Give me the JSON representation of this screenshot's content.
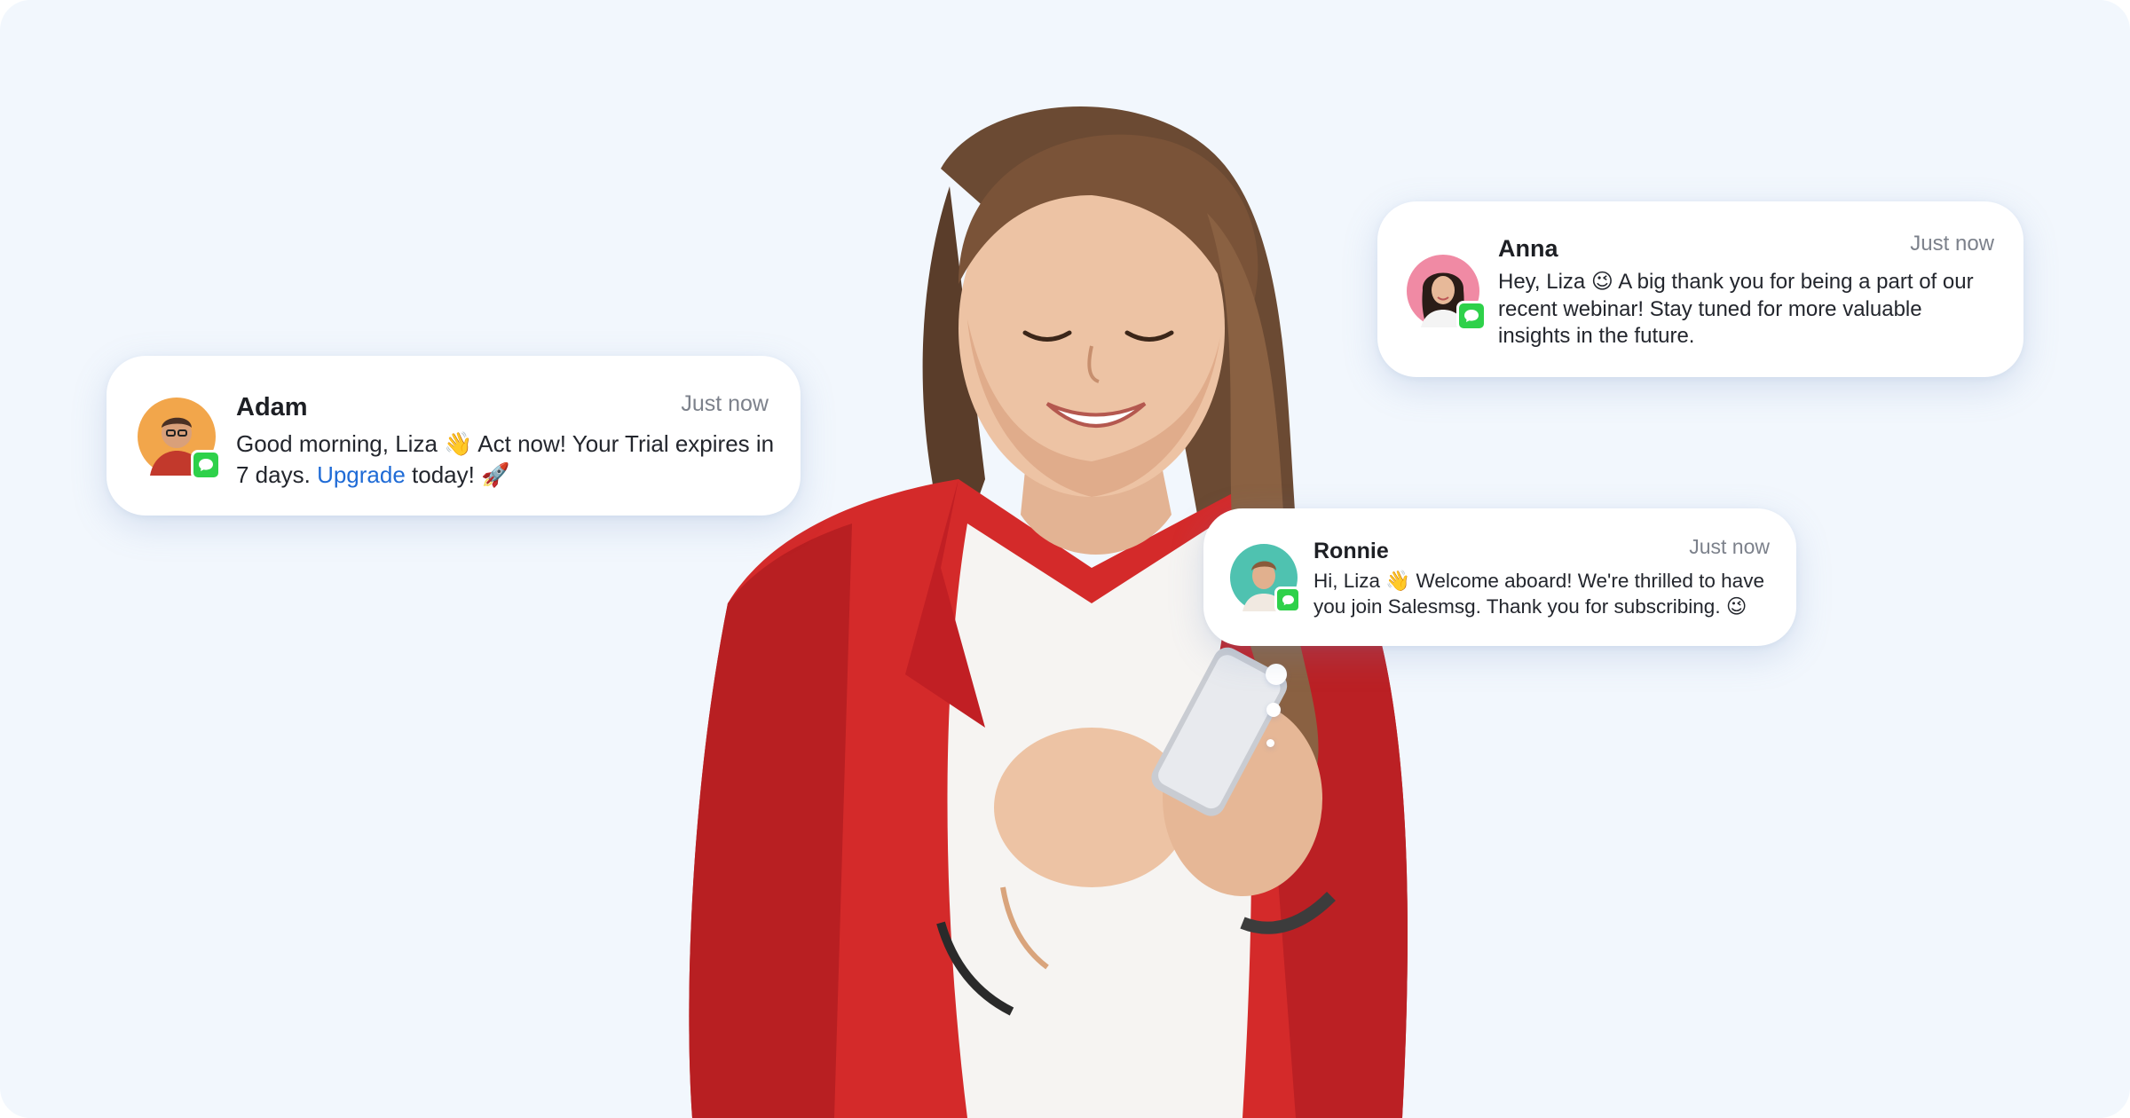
{
  "notifications": {
    "adam": {
      "name": "Adam",
      "time": "Just now",
      "message_start": "Good morning, Liza 👋 Act now! Your Trial expires in 7 days. ",
      "link_text": "Upgrade",
      "message_end": " today! 🚀",
      "avatar_icon": "person-avatar",
      "badge_icon": "message-bubble-icon"
    },
    "anna": {
      "name": "Anna",
      "time": "Just now",
      "message": "Hey, Liza 😉 A big thank you for being a part of our recent webinar! Stay tuned for more valuable insights in the future.",
      "avatar_icon": "person-avatar",
      "badge_icon": "message-bubble-icon"
    },
    "ronnie": {
      "name": "Ronnie",
      "time": "Just now",
      "message": "Hi, Liza 👋 Welcome aboard! We're thrilled to have you join Salesmsg. Thank you for subscribing. 😉",
      "avatar_icon": "person-avatar",
      "badge_icon": "message-bubble-icon"
    }
  },
  "colors": {
    "background": "#f2f7fd",
    "card": "#ffffff",
    "link": "#1f6bd6",
    "badge": "#2ed14a",
    "jacket": "#d42a2a"
  }
}
